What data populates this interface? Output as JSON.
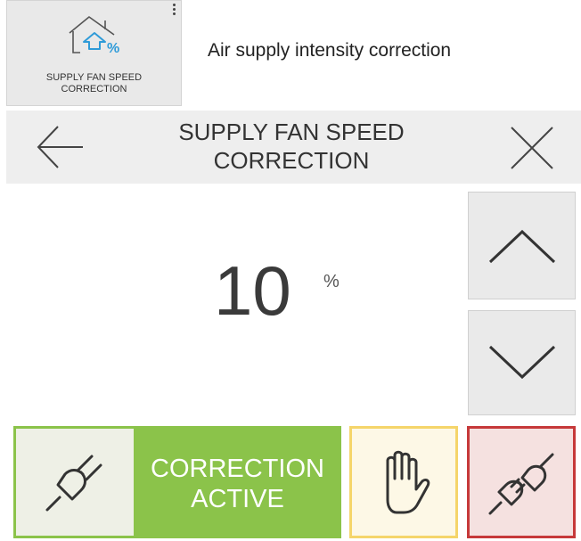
{
  "tile": {
    "label": "SUPPLY FAN SPEED\nCORRECTION",
    "icon": "house-fan-percent-icon",
    "menu_icon": "more-vert-icon"
  },
  "description": "Air supply intensity correction",
  "header": {
    "title": "SUPPLY FAN SPEED\nCORRECTION",
    "back_icon": "arrow-left-icon",
    "close_icon": "close-icon"
  },
  "value": {
    "number": "10",
    "unit": "%"
  },
  "controls": {
    "up_icon": "chevron-up-icon",
    "down_icon": "chevron-down-icon"
  },
  "status": {
    "label": "CORRECTION\nACTIVE",
    "icon": "plug-icon"
  },
  "manual": {
    "icon": "hand-icon"
  },
  "disconnect": {
    "icon": "plug-connected-icon"
  },
  "colors": {
    "active_green": "#8bc34a",
    "manual_yellow": "#f5d56a",
    "disconnect_red": "#c6393a",
    "accent_blue": "#2f9bd8"
  }
}
